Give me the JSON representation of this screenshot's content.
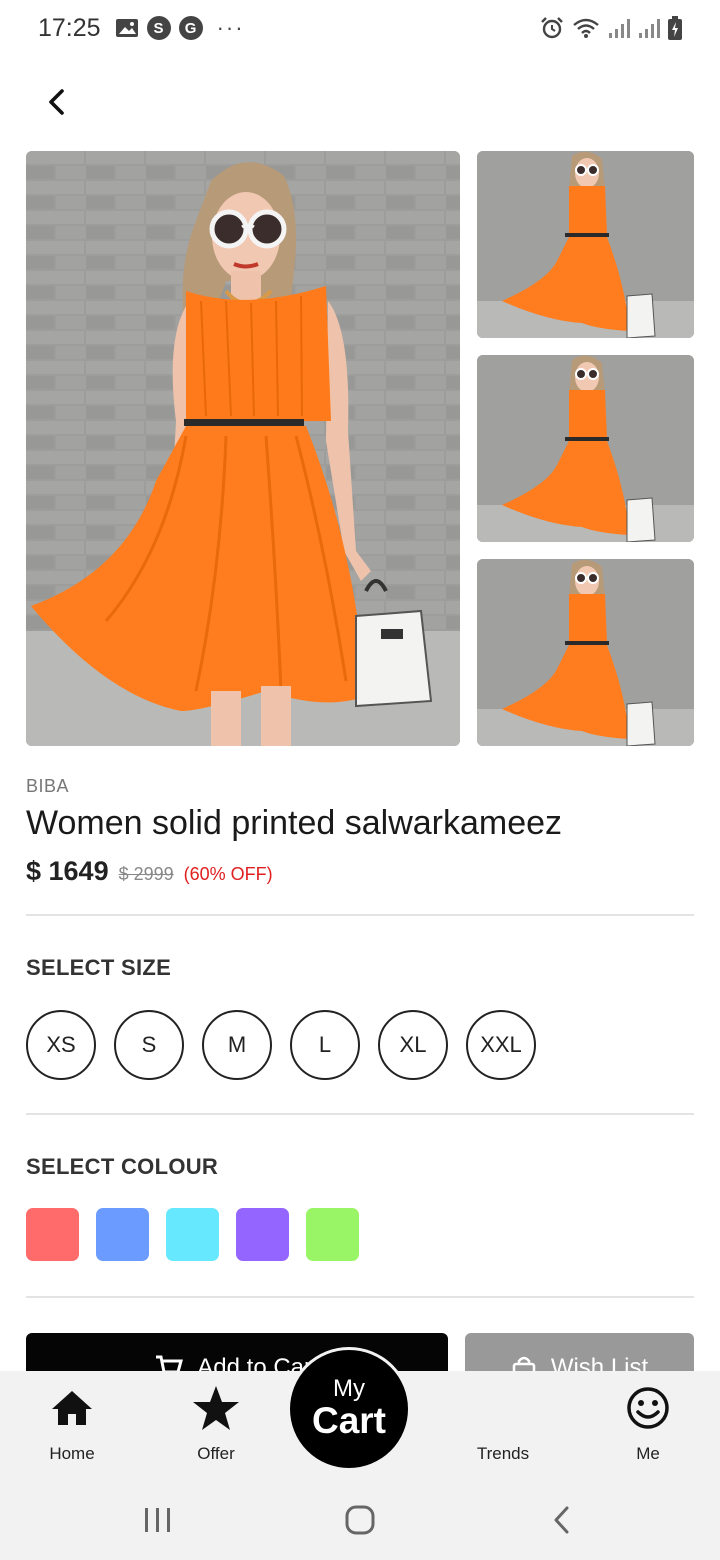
{
  "status_bar": {
    "time": "17:25",
    "left_icons": [
      "image-icon",
      "s-icon",
      "g-icon",
      "more-dots"
    ],
    "s_glyph": "S",
    "g_glyph": "G",
    "dots": "···",
    "right_icons": [
      "alarm-icon",
      "wifi-icon",
      "signal-icon",
      "signal-icon",
      "battery-charging-icon"
    ]
  },
  "header": {
    "back_icon": "chevron-left-icon"
  },
  "product": {
    "brand": "BIBA",
    "title": "Women solid printed salwarkameez",
    "price": "$ 1649",
    "mrp": "$ 2999",
    "discount": "(60% OFF)",
    "image_description": "Model in orange sleeveless dress with white handbag",
    "dress_color": "#ff7a1a"
  },
  "size_section": {
    "title": "SELECT SIZE",
    "sizes": [
      "XS",
      "S",
      "M",
      "L",
      "XL",
      "XXL"
    ]
  },
  "colour_section": {
    "title": "SELECT COLOUR",
    "colours": [
      "#ff6b6b",
      "#6b9bff",
      "#66e8ff",
      "#9466ff",
      "#99f566"
    ]
  },
  "actions": {
    "add_to_cart": "Add to Cart",
    "wish_list": "Wish List"
  },
  "bottom_nav": {
    "home": "Home",
    "offer": "Offer",
    "cart_top": "My",
    "cart_main": "Cart",
    "trends": "Trends",
    "me": "Me"
  }
}
